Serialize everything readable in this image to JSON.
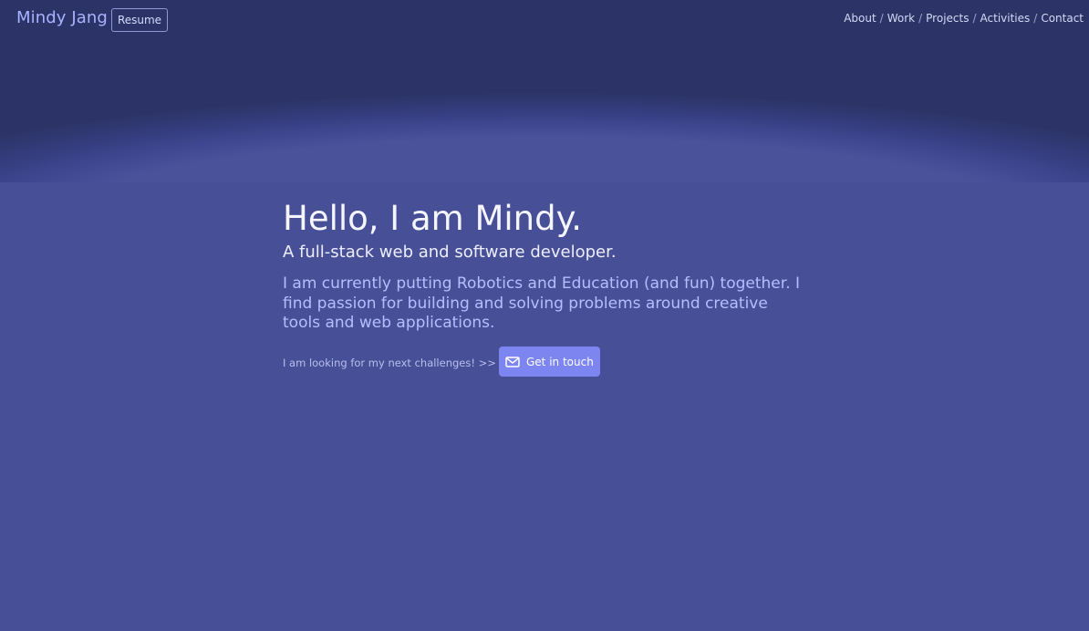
{
  "nav": {
    "brand": "Mindy Jang",
    "resume_label": "Resume",
    "links": [
      "About",
      "Work",
      "Projects",
      "Activities",
      "Contact"
    ],
    "separator": "/"
  },
  "hero": {
    "title": "Hello, I am Mindy.",
    "subtitle": "A full-stack web and software developer.",
    "description": "I am currently putting Robotics and Education (and fun) together. I find passion for building and solving problems around creative tools and web applications.",
    "cta_text": "I am looking for my next challenges! >>",
    "cta_button_label": "Get in touch",
    "cta_button_icon": "envelope-icon"
  },
  "colors": {
    "background": "#474f96",
    "header_dark": "#2c3467",
    "brand": "#a9b3ff",
    "accent_button": "#7c85f0",
    "description_text": "#b6beff"
  }
}
